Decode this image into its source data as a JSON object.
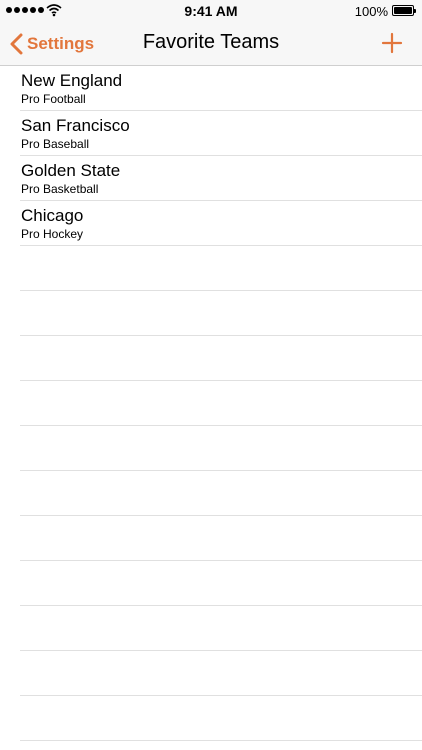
{
  "status_bar": {
    "time": "9:41 AM",
    "battery_percent": "100%",
    "battery_level": 1.0,
    "signal_icon": "signal-dots-icon",
    "wifi_icon": "wifi-icon"
  },
  "nav": {
    "back_label": "Settings",
    "title": "Favorite Teams",
    "back_icon": "chevron-left-icon",
    "add_icon": "plus-icon"
  },
  "teams": [
    {
      "name": "New England",
      "league": "Pro Football"
    },
    {
      "name": "San Francisco",
      "league": "Pro Baseball"
    },
    {
      "name": "Golden State",
      "league": "Pro Basketball"
    },
    {
      "name": "Chicago",
      "league": "Pro Hockey"
    }
  ],
  "empty_rows": 11,
  "colors": {
    "accent": "#e2763c",
    "bar_background": "#f7f7f7",
    "separator": "#e0e0e0"
  }
}
